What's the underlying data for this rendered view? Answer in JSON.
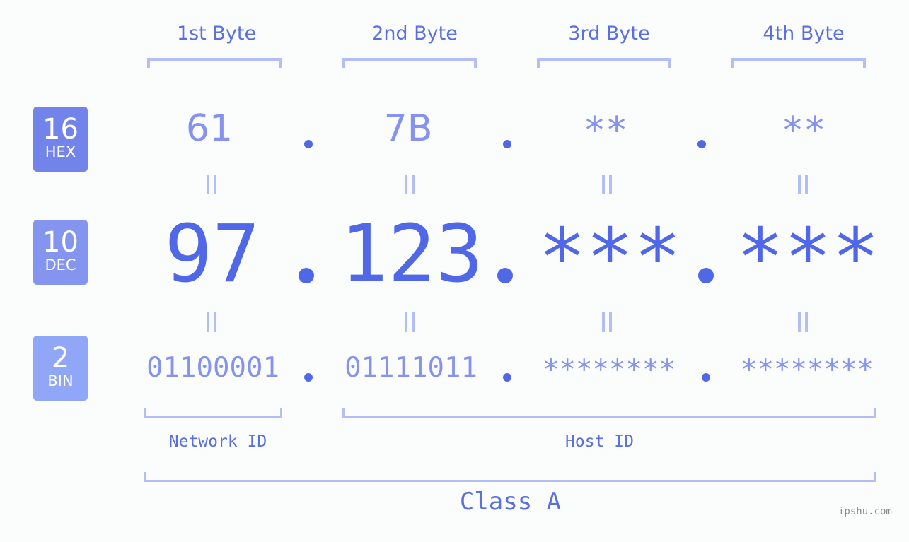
{
  "bytes": [
    {
      "title": "1st Byte",
      "hex": "61",
      "dec": "97",
      "bin": "01100001"
    },
    {
      "title": "2nd Byte",
      "hex": "7B",
      "dec": "123",
      "bin": "01111011"
    },
    {
      "title": "3rd Byte",
      "hex": "**",
      "dec": "***",
      "bin": "********"
    },
    {
      "title": "4th Byte",
      "hex": "**",
      "dec": "***",
      "bin": "********"
    }
  ],
  "badges": {
    "hex": {
      "number": "16",
      "label": "HEX",
      "color": "#7283e9"
    },
    "dec": {
      "number": "10",
      "label": "DEC",
      "color": "#8495ef"
    },
    "bin": {
      "number": "2",
      "label": "BIN",
      "color": "#90a6f6"
    }
  },
  "sections": {
    "network_id": "Network ID",
    "host_id": "Host ID",
    "class": "Class A"
  },
  "watermark": "ipshu.com",
  "colors": {
    "primary": "#5068e8",
    "light": "#8593ee",
    "bracket": "#b3bdf6",
    "label": "#5a6fe0"
  }
}
